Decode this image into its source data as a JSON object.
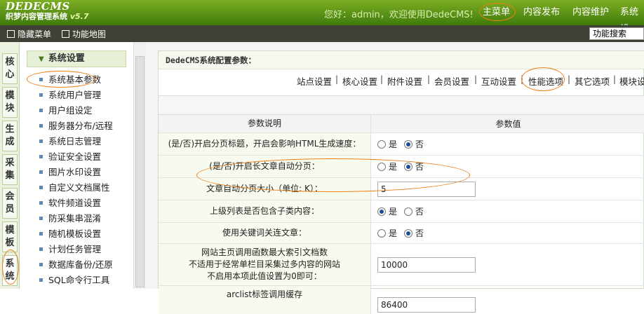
{
  "logo": {
    "title": "DEDECMS",
    "subtitle": "织梦内容管理系统",
    "version": "v5.7"
  },
  "welcome": "您好：admin，欢迎使用DedeCMS!",
  "topnav": [
    "主菜单",
    "内容发布",
    "内容维护",
    "系统设"
  ],
  "subbar": {
    "hide_menu": "隐藏菜单",
    "site_map": "功能地图",
    "search_placeholder": "功能搜索"
  },
  "lefttabs": [
    [
      "核",
      "心"
    ],
    [
      "模",
      "块"
    ],
    [
      "生",
      "成"
    ],
    [
      "采",
      "集"
    ],
    [
      "会",
      "员"
    ],
    [
      "模",
      "板"
    ],
    [
      "系",
      "统"
    ]
  ],
  "sidebar": {
    "header": "系统设置",
    "items": [
      "系统基本参数",
      "系统用户管理",
      "用户组设定",
      "服务器分布/远程",
      "系统日志管理",
      "验证安全设置",
      "图片水印设置",
      "自定义文档属性",
      "软件频道设置",
      "防采集串混淆",
      "随机模板设置",
      "计划任务管理",
      "数据库备份/还原",
      "SQL命令行工具"
    ]
  },
  "panel": {
    "title": "DedeCMS系统配置参数：",
    "tabs": [
      "站点设置",
      "核心设置",
      "附件设置",
      "会员设置",
      "互动设置",
      "性能选项",
      "其它选项",
      "模块设"
    ],
    "header": {
      "col1": "参数说明",
      "col2": "参数值"
    },
    "rows": [
      {
        "label": [
          "(是/否)开启分页标题，开启会影响HTML生成速度："
        ],
        "type": "radio",
        "value": "否"
      },
      {
        "label": [
          "(是/否)开启长文章自动分页："
        ],
        "type": "radio",
        "value": "否"
      },
      {
        "label": [
          "文章自动分页大小（单位: K）："
        ],
        "type": "text",
        "value": "5"
      },
      {
        "label": [
          "上级列表是否包含子类内容："
        ],
        "type": "radio",
        "value": "是"
      },
      {
        "label": [
          "使用关键词关连文章："
        ],
        "type": "radio",
        "value": "否"
      },
      {
        "label": [
          "网站主页调用函数最大索引文档数",
          "不适用于经常单栏目采集过多内容的网站",
          "不启用本项此值设置为0即可："
        ],
        "type": "text",
        "value": "10000"
      },
      {
        "label": [
          "arclist标签调用缓存"
        ],
        "type": "text",
        "value": "86400"
      }
    ],
    "yes": "是",
    "no": "否"
  },
  "colors": {
    "top_green": "#5e9618",
    "subbar": "#3f4036",
    "highlight": "#f07d14"
  }
}
